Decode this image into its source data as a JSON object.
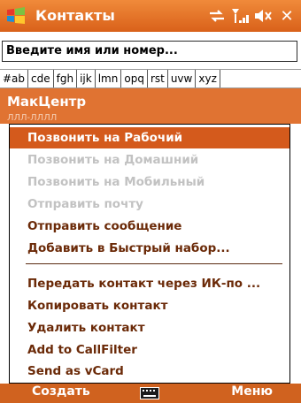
{
  "titlebar": {
    "title": "Контакты",
    "icons": [
      "windows-logo-icon",
      "connectivity-icon",
      "signal-icon",
      "volume-icon",
      "close-icon"
    ],
    "close_label": "✕"
  },
  "search": {
    "value": "Введите имя или номер..."
  },
  "alpha_bar": {
    "groups": [
      "#ab",
      "cde",
      "fgh",
      "ijk",
      "lmn",
      "opq",
      "rst",
      "uvw",
      "xyz"
    ]
  },
  "contact": {
    "name": "МакЦентр",
    "sub": "ЛЛЛ-ЛЛЛЛ"
  },
  "menu": {
    "items": [
      {
        "label": "Позвонить на Рабочий",
        "state": "selected"
      },
      {
        "label": "Позвонить на Домашний",
        "state": "disabled"
      },
      {
        "label": "Позвонить на Мобильный",
        "state": "disabled"
      },
      {
        "label": "Отправить почту",
        "state": "disabled"
      },
      {
        "label": "Отправить сообщение",
        "state": "enabled"
      },
      {
        "label": "Добавить в Быстрый набор...",
        "state": "enabled"
      },
      {
        "label": "Передать контакт через ИК-по ...",
        "state": "enabled"
      },
      {
        "label": "Копировать контакт",
        "state": "enabled"
      },
      {
        "label": "Удалить контакт",
        "state": "enabled"
      },
      {
        "label": "Add to CallFilter",
        "state": "enabled"
      },
      {
        "label": "Send as vCard",
        "state": "enabled"
      }
    ]
  },
  "softkeys": {
    "left": "Создать",
    "right": "Меню"
  },
  "colors": {
    "accent": "#e07332",
    "selected": "#d45a1c",
    "menu_text": "#6b2a08",
    "disabled_text": "#c2c2c2"
  }
}
